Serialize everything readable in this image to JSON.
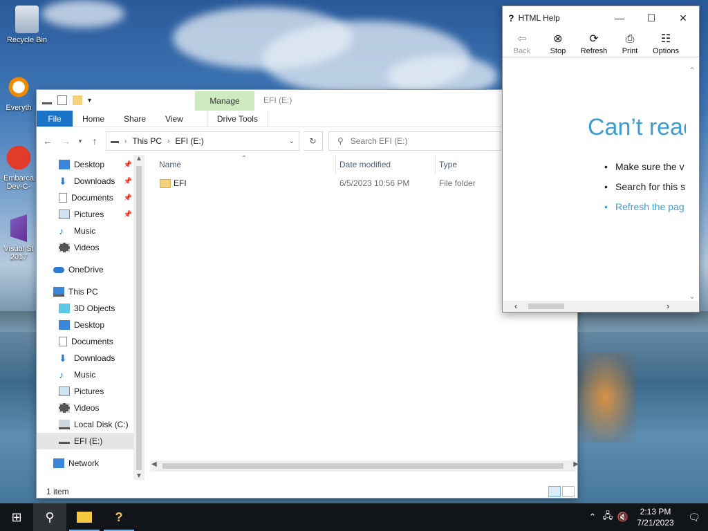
{
  "desktop": {
    "icons": [
      {
        "label": "Recycle Bin"
      },
      {
        "label": "Everyth"
      },
      {
        "label": "Embarca Dev-C-"
      },
      {
        "label": "Visual St 2017"
      }
    ]
  },
  "explorer": {
    "title": "EFI (E:)",
    "contextual_tab": "Manage",
    "ribbon_tabs": [
      "File",
      "Home",
      "Share",
      "View",
      "Drive Tools"
    ],
    "address": {
      "segments": [
        "This PC",
        "EFI (E:)"
      ]
    },
    "search": {
      "placeholder": "Search EFI (E:)"
    },
    "nav": {
      "quick_access": [
        {
          "label": "Desktop",
          "icon": "desktop-icon",
          "pinned": true
        },
        {
          "label": "Downloads",
          "icon": "download-icon",
          "pinned": true
        },
        {
          "label": "Documents",
          "icon": "document-icon",
          "pinned": true
        },
        {
          "label": "Pictures",
          "icon": "picture-icon",
          "pinned": true
        },
        {
          "label": "Music",
          "icon": "music-icon",
          "pinned": false
        },
        {
          "label": "Videos",
          "icon": "video-icon",
          "pinned": false
        }
      ],
      "onedrive": "OneDrive",
      "this_pc": "This PC",
      "this_pc_items": [
        {
          "label": "3D Objects",
          "icon": "cube-icon"
        },
        {
          "label": "Desktop",
          "icon": "desktop-icon"
        },
        {
          "label": "Documents",
          "icon": "document-icon"
        },
        {
          "label": "Downloads",
          "icon": "download-icon"
        },
        {
          "label": "Music",
          "icon": "music-icon"
        },
        {
          "label": "Pictures",
          "icon": "picture-icon"
        },
        {
          "label": "Videos",
          "icon": "video-icon"
        },
        {
          "label": "Local Disk (C:)",
          "icon": "disk-icon"
        },
        {
          "label": "EFI (E:)",
          "icon": "drive-icon",
          "selected": true
        }
      ],
      "network": "Network"
    },
    "columns": {
      "name": "Name",
      "date": "Date modified",
      "type": "Type"
    },
    "files": [
      {
        "name": "EFI",
        "date": "6/5/2023 10:56 PM",
        "type": "File folder"
      }
    ],
    "status": "1 item"
  },
  "help_window": {
    "title": "HTML Help",
    "toolbar": [
      {
        "label": "Back",
        "icon": "back-arrow-icon",
        "enabled": false
      },
      {
        "label": "Stop",
        "icon": "stop-icon",
        "enabled": true
      },
      {
        "label": "Refresh",
        "icon": "refresh-icon",
        "enabled": true
      },
      {
        "label": "Print",
        "icon": "print-icon",
        "enabled": true
      },
      {
        "label": "Options",
        "icon": "options-icon",
        "enabled": true
      }
    ],
    "heading": "Can’t reac",
    "bullets": [
      "Make sure the v",
      "Search for this s",
      "Refresh the pag"
    ]
  },
  "taskbar": {
    "time": "2:13 PM",
    "date": "7/21/2023"
  },
  "colors": {
    "accent": "#1a73c6",
    "manage_tab": "#cdeac0",
    "help_heading": "#3b9cd6"
  }
}
